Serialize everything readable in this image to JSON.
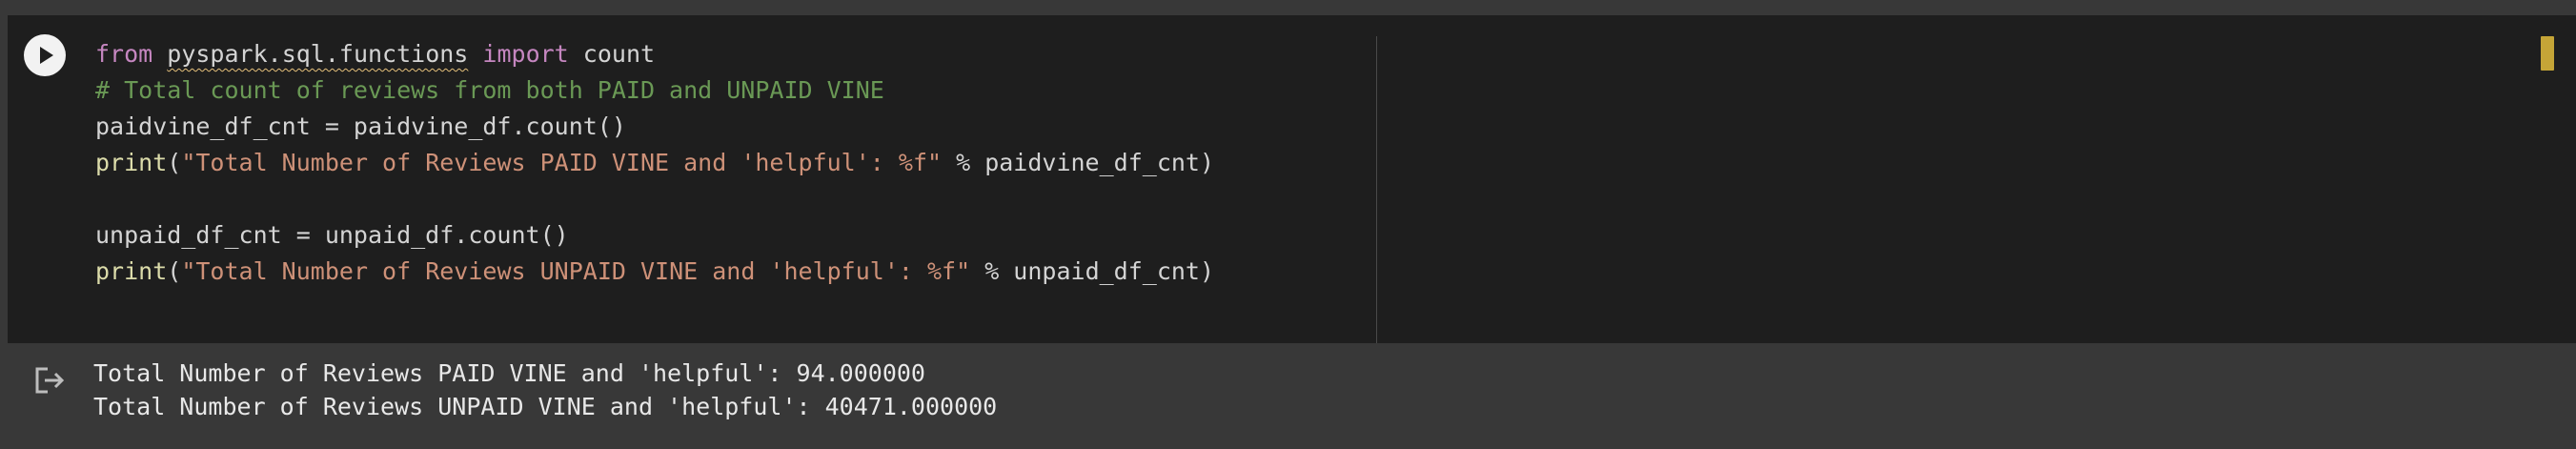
{
  "cell": {
    "code": {
      "line1": {
        "kw1": "from",
        "module": "pyspark.sql.functions",
        "kw2": "import",
        "name": "count"
      },
      "line2": {
        "comment": "# Total count of reviews from both PAID and UNPAID VINE"
      },
      "line3": {
        "text": "paidvine_df_cnt = paidvine_df.count()"
      },
      "line4": {
        "fn": "print",
        "open": "(",
        "str": "\"Total Number of Reviews PAID VINE and 'helpful': %f\"",
        "rest": " % paidvine_df_cnt)"
      },
      "line5": {
        "text": ""
      },
      "line6": {
        "text": "unpaid_df_cnt = unpaid_df.count()"
      },
      "line7": {
        "fn": "print",
        "open": "(",
        "str": "\"Total Number of Reviews UNPAID VINE and 'helpful': %f\"",
        "rest": " % unpaid_df_cnt)"
      }
    },
    "output": {
      "lines": [
        "Total Number of Reviews PAID VINE and 'helpful': 94.000000",
        "Total Number of Reviews UNPAID VINE and 'helpful': 40471.000000"
      ]
    }
  },
  "icons": {
    "run": "play-icon",
    "output": "output-redirect-icon"
  },
  "colors": {
    "cell_background": "#1e1e1e",
    "page_background": "#383838",
    "keyword": "#c586c0",
    "comment": "#6a9955",
    "string": "#ce9178",
    "function": "#dcdcaa",
    "text": "#d4d4d4",
    "scroll_marker": "#c5a537"
  }
}
